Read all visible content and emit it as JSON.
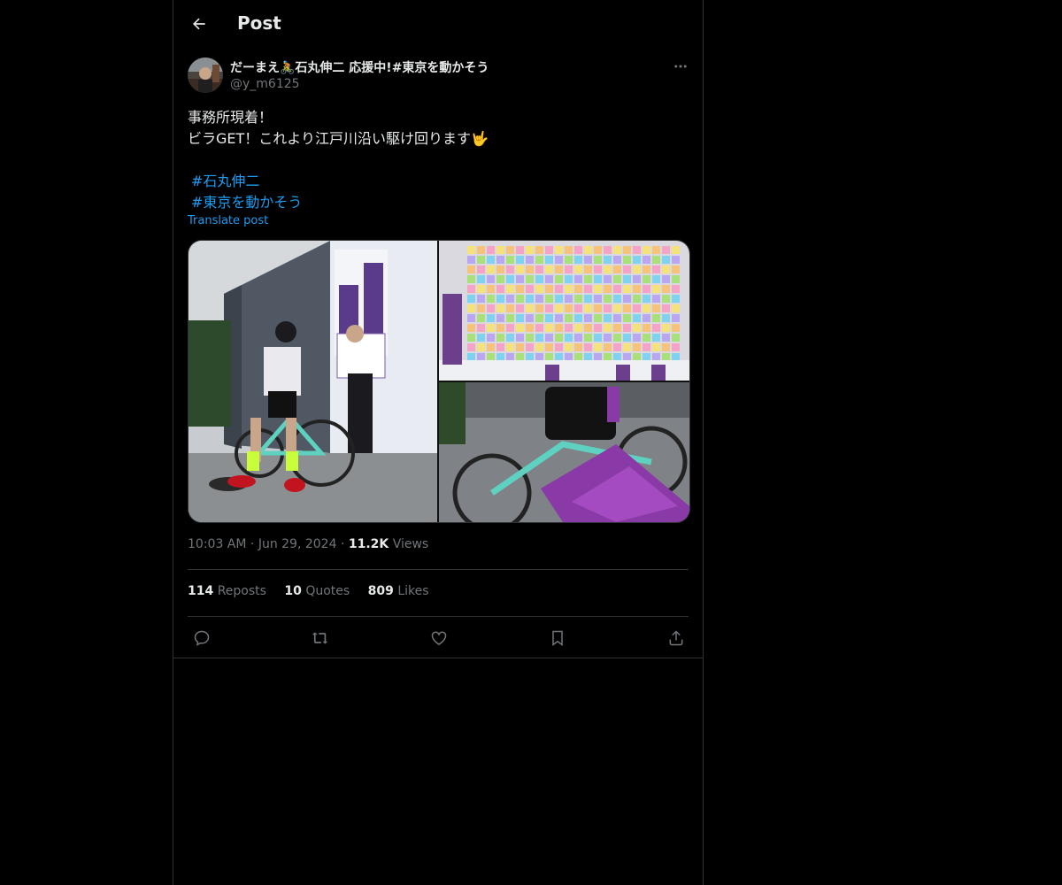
{
  "header": {
    "title": "Post",
    "back_icon": "arrow-left-icon"
  },
  "author": {
    "display_name": "だーまえ🚴石丸伸二 応援中!#東京を動かそう",
    "handle": "@y_m6125",
    "more_icon": "ellipsis-icon"
  },
  "post": {
    "lines": [
      "事務所現着！",
      "ビラGET！これより江戸川沿い駆け回ります🤟"
    ],
    "hashtags": [
      "#石丸伸二",
      "#東京を動かそう"
    ],
    "translate_label": "Translate post"
  },
  "media": {
    "count": 3
  },
  "meta": {
    "time": "10:03 AM",
    "date": "Jun 29, 2024",
    "views_count": "11.2K",
    "views_label": "Views",
    "separator": "·"
  },
  "stats": {
    "reposts_count": "114",
    "reposts_label": "Reposts",
    "quotes_count": "10",
    "quotes_label": "Quotes",
    "likes_count": "809",
    "likes_label": "Likes"
  },
  "actions": [
    "reply-icon",
    "repost-icon",
    "like-icon",
    "bookmark-icon",
    "share-icon"
  ],
  "colors": {
    "background": "#000000",
    "text": "#e7e9ea",
    "muted": "#71767b",
    "accent": "#1d9bf0",
    "border": "#2f3336"
  }
}
